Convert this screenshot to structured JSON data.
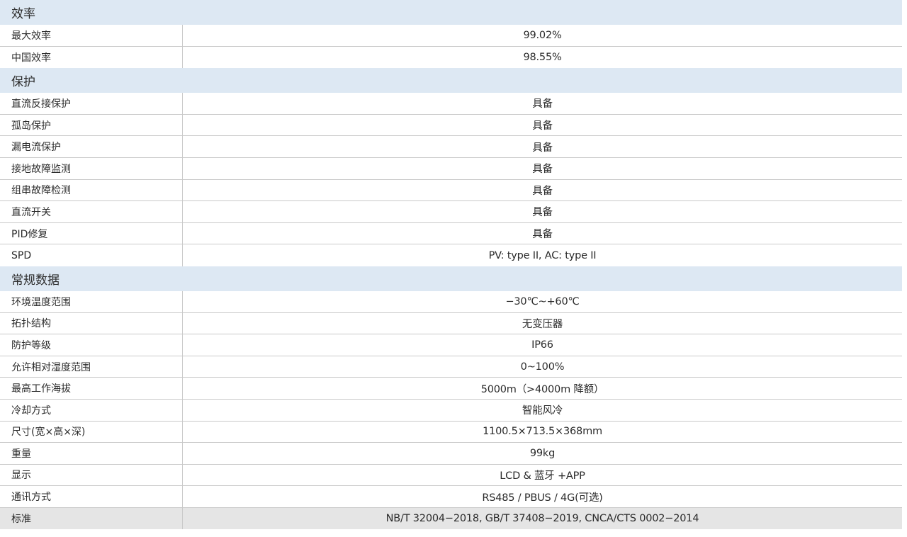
{
  "sections": [
    {
      "title": "效率",
      "rows": [
        {
          "label": "最大效率",
          "value": "99.02%"
        },
        {
          "label": "中国效率",
          "value": "98.55%"
        }
      ]
    },
    {
      "title": "保护",
      "rows": [
        {
          "label": "直流反接保护",
          "value": "具备"
        },
        {
          "label": "孤岛保护",
          "value": "具备"
        },
        {
          "label": "漏电流保护",
          "value": "具备"
        },
        {
          "label": "接地故障监测",
          "value": "具备"
        },
        {
          "label": "组串故障检测",
          "value": "具备"
        },
        {
          "label": "直流开关",
          "value": "具备"
        },
        {
          "label": "PID修复",
          "value": "具备"
        },
        {
          "label": "SPD",
          "value": "PV: type II, AC: type II"
        }
      ]
    },
    {
      "title": "常规数据",
      "rows": [
        {
          "label": "环境温度范围",
          "value": "−30℃~+60℃"
        },
        {
          "label": "拓扑结构",
          "value": "无变压器"
        },
        {
          "label": "防护等级",
          "value": "IP66"
        },
        {
          "label": "允许相对湿度范围",
          "value": "0~100%"
        },
        {
          "label": "最高工作海拔",
          "value": "5000m（>4000m 降额）"
        },
        {
          "label": "冷却方式",
          "value": "智能风冷"
        },
        {
          "label": "尺寸(宽×高×深)",
          "value": "1100.5×713.5×368mm"
        },
        {
          "label": "重量",
          "value": "99kg"
        },
        {
          "label": "显示",
          "value": "LCD & 蓝牙 +APP"
        },
        {
          "label": "通讯方式",
          "value": "RS485 / PBUS / 4G(可选)"
        },
        {
          "label": "标准",
          "value": "NB/T 32004−2018, GB/T 37408−2019, CNCA/CTS 0002−2014"
        }
      ]
    }
  ],
  "colors": {
    "section_header_bg": "#dde8f3",
    "row_border": "#c9c9c9",
    "shaded_row_bg": "#e5e5e5",
    "text": "#2b2b2b"
  }
}
